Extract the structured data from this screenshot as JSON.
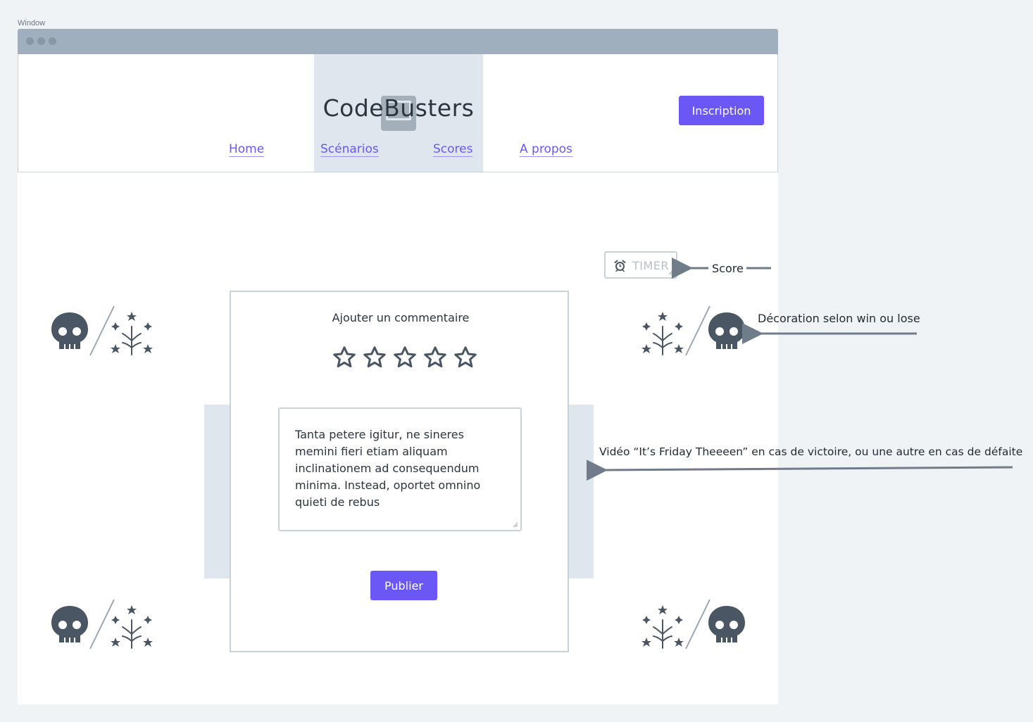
{
  "window": {
    "label": "Window"
  },
  "header": {
    "logo_text": "CodeBusters",
    "nav": [
      {
        "label": "Home"
      },
      {
        "label": "Scénarios"
      },
      {
        "label": "Scores"
      },
      {
        "label": "A propos"
      }
    ],
    "signup_label": "Inscription"
  },
  "timer": {
    "label": "TIMER",
    "icon": "alarm-clock-icon"
  },
  "comment_card": {
    "title": "Ajouter un commentaire",
    "rating": {
      "filled": 0,
      "max": 5
    },
    "textarea_value": "Tanta petere igitur, ne sineres memini fieri etiam aliquam inclinationem ad consequendum minima. Instead, oportet omnino quieti de rebus",
    "publish_label": "Publier"
  },
  "decorations": {
    "icons": [
      "skull-icon",
      "fireworks-icon"
    ]
  },
  "annotations": {
    "score": "Score",
    "decoration": "Décoration selon win ou lose",
    "video": "Vidéo “It’s Friday Theeeen” en cas de victoire, ou une autre en cas de défaite"
  },
  "colors": {
    "accent": "#6b57f5",
    "border": "#c9d1d9",
    "icon": "#4a5663",
    "arrow": "#707c89"
  }
}
